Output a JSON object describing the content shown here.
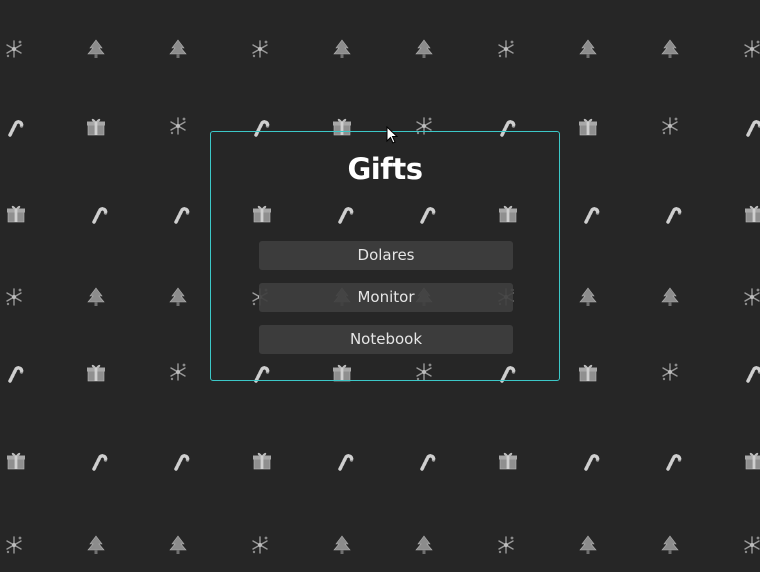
{
  "dialog": {
    "title": "Gifts",
    "options": [
      {
        "label": "Dolares"
      },
      {
        "label": "Monitor"
      },
      {
        "label": "Notebook"
      }
    ]
  },
  "background": {
    "pattern_icons": [
      "snowflake-icon",
      "tree-icon",
      "candy-cane-icon",
      "gift-icon"
    ]
  },
  "colors": {
    "background": "#262626",
    "panel_border": "#3cc8c8",
    "button_bg": "#3e3e3e",
    "title_text": "#ffffff",
    "button_text": "#e6e6e6"
  }
}
